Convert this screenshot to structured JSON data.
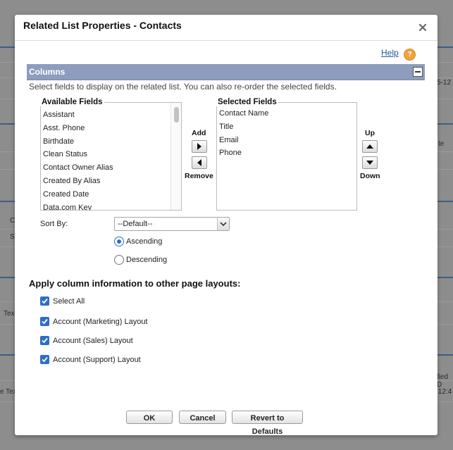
{
  "background": {
    "snippets": [
      "5-12",
      "te",
      "C",
      "S",
      "Tex",
      "fied D",
      "e Tex",
      ":12:4"
    ]
  },
  "dialog": {
    "title": "Related List Properties - Contacts",
    "help_label": "Help",
    "help_icon_glyph": "?",
    "section_title": "Columns",
    "section_description": "Select fields to display on the related list. You can also re-order the selected fields."
  },
  "available_fields": {
    "label": "Available Fields",
    "items": [
      "Assistant",
      "Asst. Phone",
      "Birthdate",
      "Clean Status",
      "Contact Owner Alias",
      "Created By Alias",
      "Created Date",
      "Data.com Key"
    ]
  },
  "selected_fields": {
    "label": "Selected Fields",
    "items": [
      "Contact Name",
      "Title",
      "Email",
      "Phone"
    ]
  },
  "move_controls": {
    "add_label": "Add",
    "remove_label": "Remove",
    "up_label": "Up",
    "down_label": "Down"
  },
  "sort": {
    "label": "Sort By:",
    "selected": "--Default--",
    "options": [
      "Ascending",
      "Descending"
    ],
    "selected_order": "Ascending"
  },
  "apply": {
    "title": "Apply column information to other page layouts:",
    "checkboxes": [
      {
        "label": "Select All",
        "checked": true
      },
      {
        "label": "Account (Marketing) Layout",
        "checked": true
      },
      {
        "label": "Account (Sales) Layout",
        "checked": true
      },
      {
        "label": "Account (Support) Layout",
        "checked": true
      }
    ]
  },
  "footer": {
    "ok_label": "OK",
    "cancel_label": "Cancel",
    "revert_label": "Revert to Defaults"
  },
  "colors": {
    "section_bar": "#8e9dbd",
    "link": "#1e5a96",
    "checkbox": "#2d6ec9",
    "help_icon": "#f0a43a"
  }
}
